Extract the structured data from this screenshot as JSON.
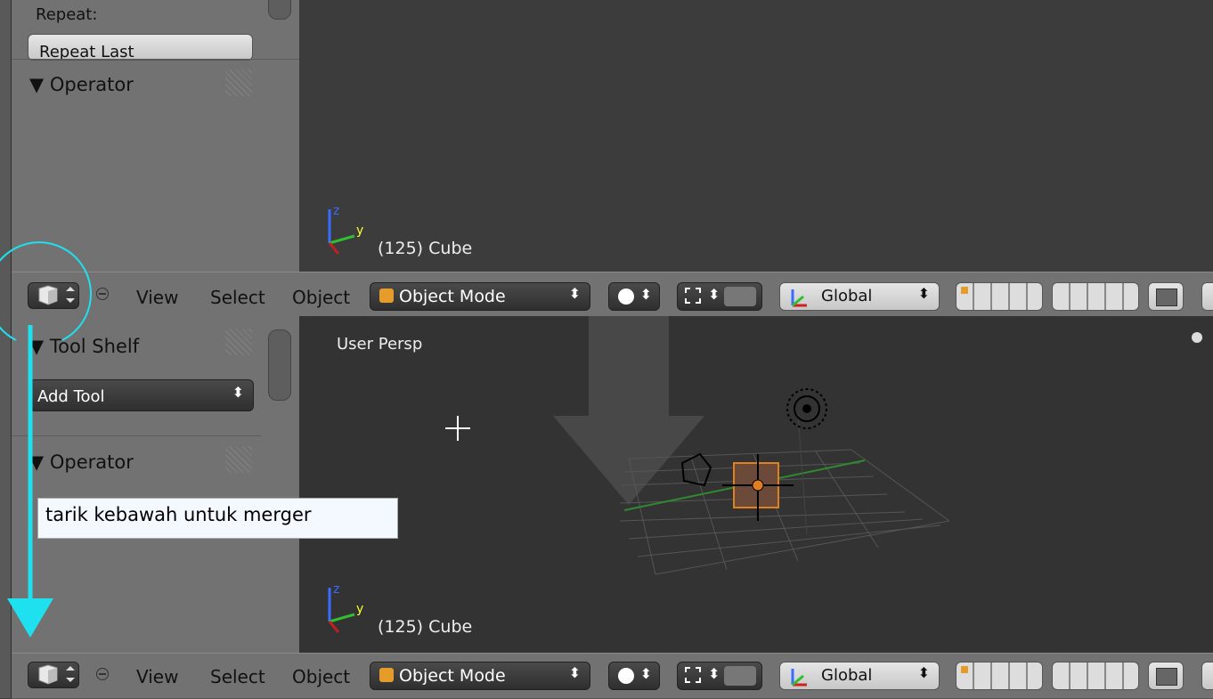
{
  "top_panel": {
    "repeat_label": "Repeat:",
    "repeat_last_button": "Repeat Last",
    "operator_section": "Operator"
  },
  "top_viewport": {
    "object_info": "(125) Cube"
  },
  "header": {
    "view_menu": "View",
    "select_menu": "Select",
    "object_menu": "Object",
    "mode_select": "Object Mode",
    "orientation_select": "Global"
  },
  "bottom_panel": {
    "tool_shelf_section": "Tool Shelf",
    "add_tool_select": "Add Tool",
    "operator_section": "Operator"
  },
  "bottom_viewport": {
    "view_label": "User Persp",
    "object_info": "(125) Cube"
  },
  "annotation": {
    "callout_text": "tarik kebawah untuk merger",
    "accent_color": "#1fe0ef"
  },
  "axis_labels": {
    "z": "z",
    "y": "y"
  }
}
